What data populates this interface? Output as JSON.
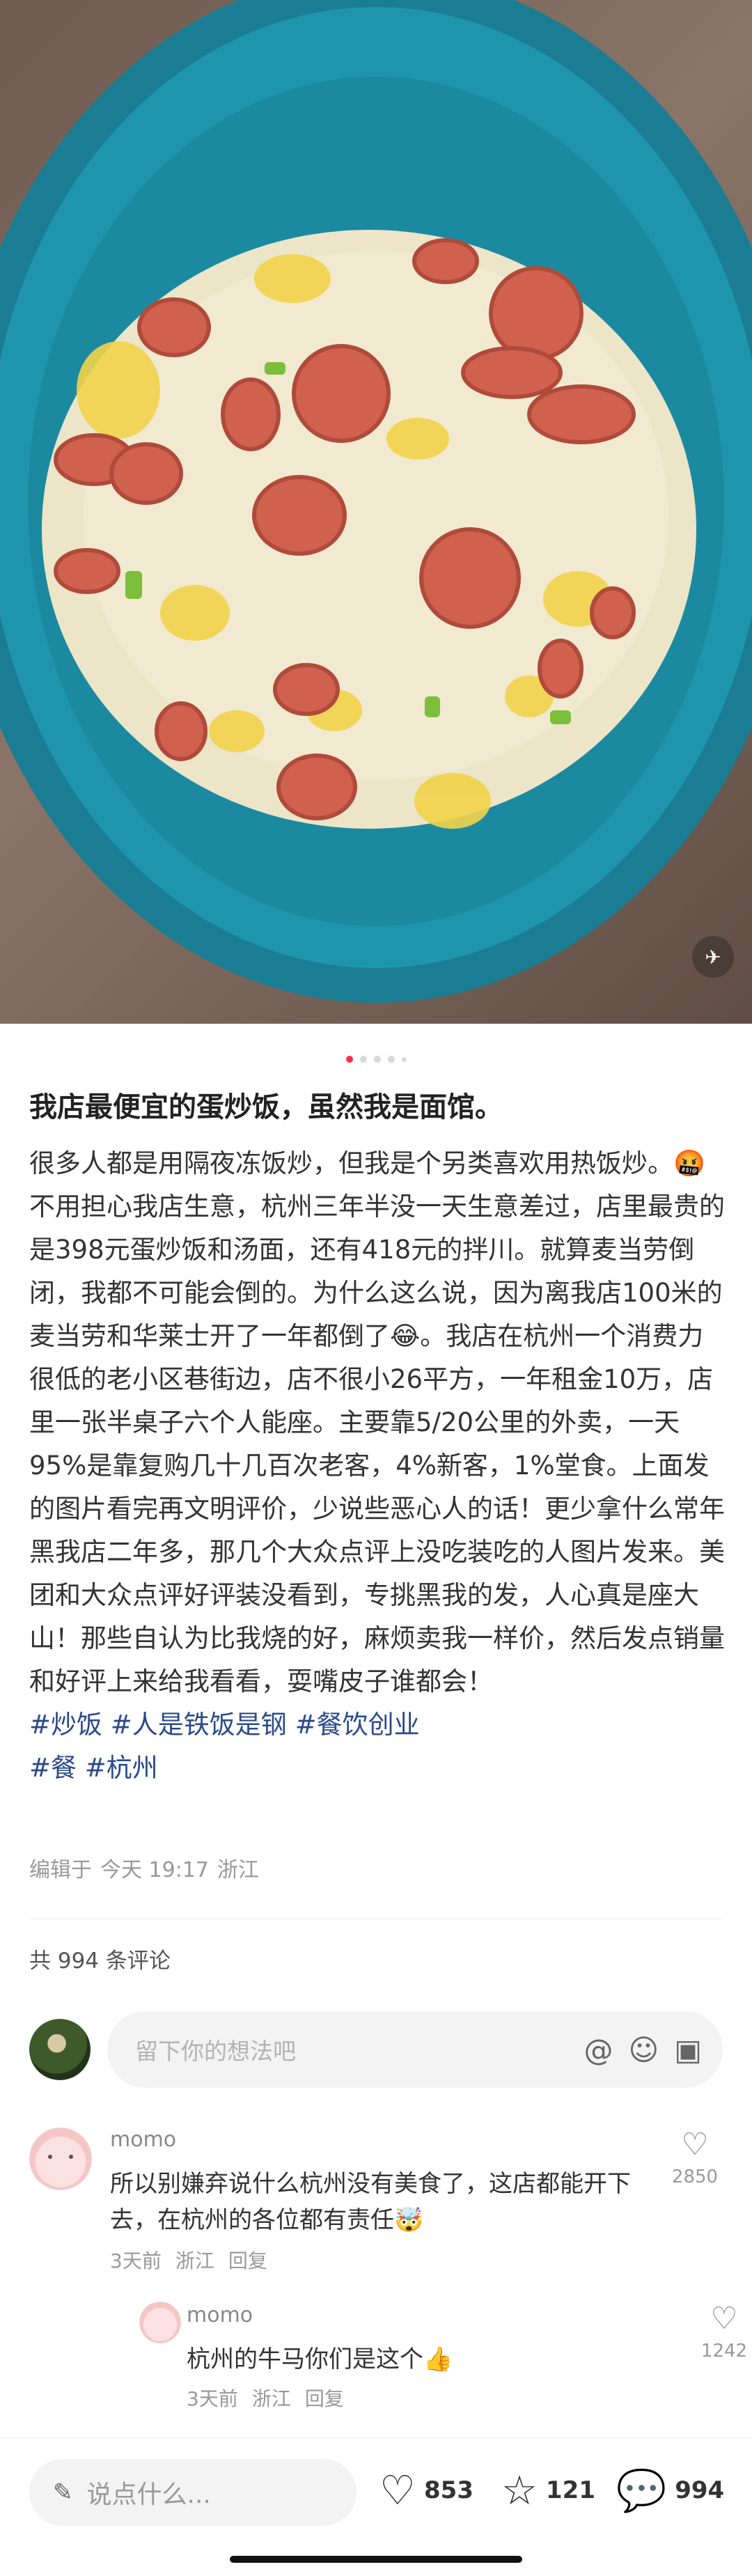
{
  "post": {
    "title": "我店最便宜的蛋炒饭，虽然我是面馆。",
    "body_text": "很多人都是用隔夜冻饭炒，但我是个另类喜欢用热饭炒。🤬 不用担心我店生意，杭州三年半没一天生意差过，店里最贵的是398元蛋炒饭和汤面，还有418元的拌川。就算麦当劳倒闭，我都不可能会倒的。为什么这么说，因为离我店100米的麦当劳和华莱士开了一年都倒了😂。我店在杭州一个消费力很低的老小区巷街边，店不很小26平方，一年租金10万，店里一张半桌子六个人能座。主要靠5/20公里的外卖，一天95%是靠复购几十几百次老客，4%新客，1%堂食。上面发的图片看完再文明评价，少说些恶心人的话！更少拿什么常年黑我店二年多，那几个大众点评上没吃装吃的人图片发来。美团和大众点评好评装没看到，专挑黑我的发，人心真是座大山！那些自认为比我烧的好，麻烦卖我一样价，然后发点销量和好评上来给我看看，耍嘴皮子谁都会！",
    "tags": [
      "#炒饭",
      "#人是铁饭是钢",
      "#餐饮创业",
      "#餐",
      "#杭州"
    ],
    "meta": {
      "edited": "编辑于",
      "time": "今天 19:17",
      "location": "浙江"
    },
    "comment_count": "共 994 条评论",
    "image_pager": {
      "current": 1,
      "total": 5
    }
  },
  "comment_box": {
    "placeholder": "留下你的想法吧",
    "icons": [
      "at-icon",
      "emoji-icon",
      "image-icon"
    ]
  },
  "comments": [
    {
      "user": "momo",
      "text": "所以别嫌弃说什么杭州没有美食了，这店都能开下去，在杭州的各位都有责任🤯",
      "time": "3天前",
      "location": "浙江",
      "reply": "回复",
      "likes": "2850",
      "replies": [
        {
          "user": "momo",
          "text": "杭州的牛马你们是这个👍",
          "time": "3天前",
          "location": "浙江",
          "reply": "回复",
          "likes": "1242"
        }
      ]
    }
  ],
  "bottom_bar": {
    "say_placeholder": "说点什么...",
    "likes": "853",
    "favorites": "121",
    "comments": "994"
  },
  "colors": {
    "accent": "#ff2d4a",
    "tag": "#2a4a8a",
    "bowl": "#1d8aa0"
  }
}
